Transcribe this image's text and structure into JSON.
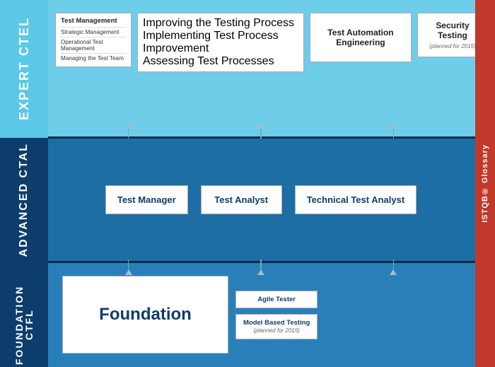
{
  "left": {
    "expert_label": "EXPERT CTEL",
    "advanced_label": "ADVANCED CTAL",
    "foundation_label": "FOUNDATION CTFL"
  },
  "right": {
    "label": "ISTQB® Glossary"
  },
  "expert": {
    "card1": {
      "title": "Test Management",
      "items": [
        "Strategic Management",
        "Operational Test Management",
        "Managing the Test Team"
      ]
    },
    "card2": {
      "title": "Improving the Testing Process",
      "items": [
        "Implementing Test Process Improvement",
        "Assessing Test Processes"
      ]
    },
    "card3": {
      "title": "Test Automation Engineering"
    },
    "card4": {
      "title": "Security Testing",
      "note": "(planned for 2015)"
    }
  },
  "advanced": {
    "card1": "Test Manager",
    "card2": "Test Analyst",
    "card3": "Technical Test Analyst"
  },
  "foundation": {
    "main": "Foundation",
    "card1": "Agile Tester",
    "card2_line1": "Model Based Testing",
    "card2_note": "(planned for 2015)"
  },
  "colors": {
    "expert_bg": "#6ecde8",
    "advanced_bg": "#1c6ea4",
    "foundation_bg": "#2980b9",
    "left_expert_bg": "#5bc8e8",
    "left_adv_bg": "#0d3d6b",
    "right_bg": "#c0392b",
    "white": "#ffffff",
    "text_dark": "#0d3d6b"
  }
}
